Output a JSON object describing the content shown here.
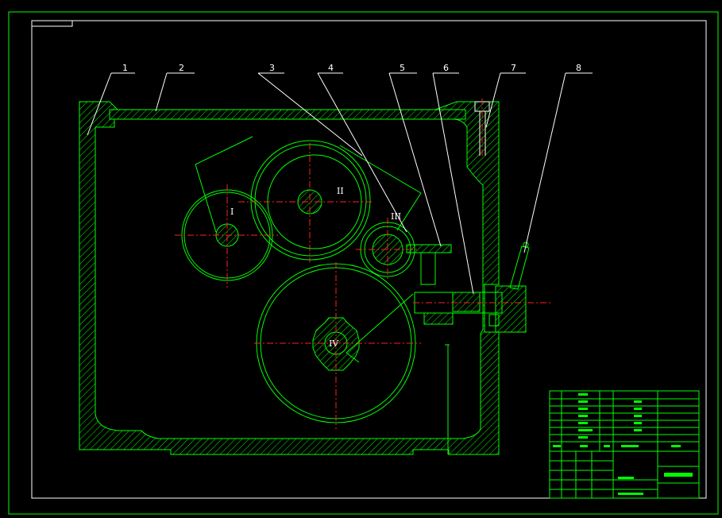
{
  "drawing": {
    "part_labels": [
      {
        "id": "1",
        "text": "1"
      },
      {
        "id": "2",
        "text": "2"
      },
      {
        "id": "3",
        "text": "3"
      },
      {
        "id": "4",
        "text": "4"
      },
      {
        "id": "5",
        "text": "5"
      },
      {
        "id": "6",
        "text": "6"
      },
      {
        "id": "7",
        "text": "7"
      },
      {
        "id": "8",
        "text": "8"
      }
    ],
    "shaft_labels": {
      "I": "I",
      "II": "II",
      "III": "III",
      "IV": "IV"
    },
    "colors": {
      "background": "#000000",
      "outline": "#00ff00",
      "leader": "#ffffff",
      "centerline": "#ff2020"
    }
  }
}
